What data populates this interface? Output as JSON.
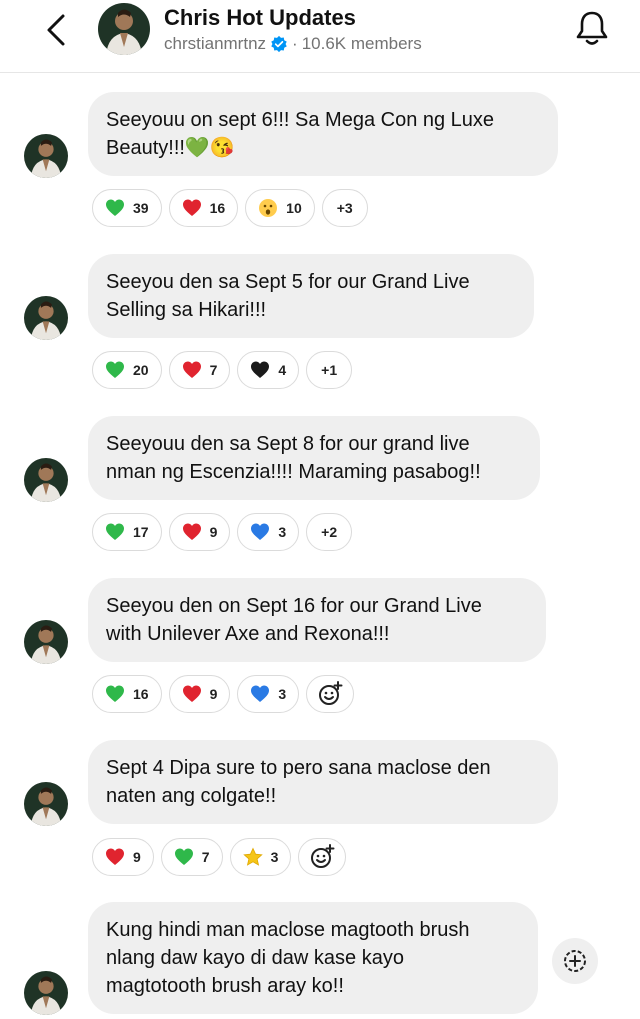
{
  "header": {
    "title": "Chris Hot Updates",
    "username": "chrstianmrtnz",
    "separator": "·",
    "members": "10.6K members"
  },
  "colors": {
    "green": "#2fb84a",
    "red": "#e0242f",
    "black": "#1a1a1a",
    "blue": "#2a7ae4",
    "yellow": "#f5c518",
    "verified": "#0095f6"
  },
  "messages": [
    {
      "text": "Seeyouu on sept 6!!! Sa Mega Con ng Luxe\nBeauty!!!💚😘",
      "reactions": [
        {
          "icon": "green-heart",
          "count": "39"
        },
        {
          "icon": "red-heart",
          "count": "16"
        },
        {
          "icon": "surprised-face",
          "count": "10"
        }
      ],
      "more": "+3"
    },
    {
      "text": "Seeyou den sa Sept 5 for our Grand Live\nSelling sa Hikari!!!",
      "reactions": [
        {
          "icon": "green-heart",
          "count": "20"
        },
        {
          "icon": "red-heart",
          "count": "7"
        },
        {
          "icon": "black-heart",
          "count": "4"
        }
      ],
      "more": "+1"
    },
    {
      "text": "Seeyouu den sa Sept 8 for our grand live\nnman ng Escenzia!!!! Maraming pasabog!!",
      "reactions": [
        {
          "icon": "green-heart",
          "count": "17"
        },
        {
          "icon": "red-heart",
          "count": "9"
        },
        {
          "icon": "blue-heart",
          "count": "3"
        }
      ],
      "more": "+2"
    },
    {
      "text": "Seeyou den on Sept 16 for our Grand Live\nwith Unilever Axe and Rexona!!!",
      "reactions": [
        {
          "icon": "green-heart",
          "count": "16"
        },
        {
          "icon": "red-heart",
          "count": "9"
        },
        {
          "icon": "blue-heart",
          "count": "3"
        }
      ],
      "more": ""
    },
    {
      "text": "Sept 4 Dipa sure to pero sana maclose den\nnaten ang colgate!!",
      "reactions": [
        {
          "icon": "red-heart",
          "count": "9"
        },
        {
          "icon": "green-heart",
          "count": "7"
        },
        {
          "icon": "star",
          "count": "3"
        }
      ],
      "more": ""
    },
    {
      "text": "Kung hindi man maclose magtooth brush\nnlang daw kayo di daw kase kayo\nmagtotooth brush aray ko!!",
      "reactions": [],
      "more": ""
    }
  ]
}
